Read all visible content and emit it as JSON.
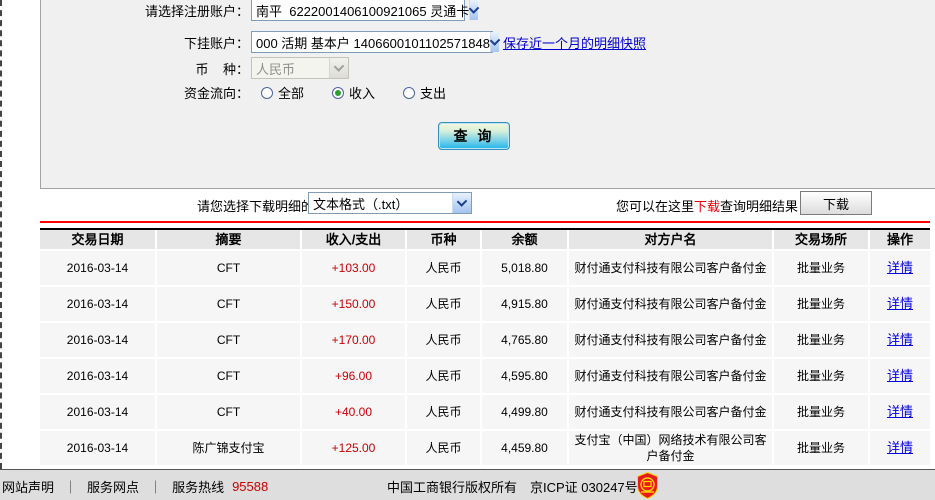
{
  "form": {
    "register_account": {
      "label": "请选择注册账户：",
      "value": "南平  6222001406100921065 灵通卡"
    },
    "sub_account": {
      "label": "下挂账户：",
      "value": "000 活期 基本户 1406600101102571848"
    },
    "snapshot_link": "保存近一个月的明细快照",
    "currency": {
      "label": "币    种：",
      "value": "人民币"
    },
    "flow": {
      "label": "资金流向：",
      "options": [
        {
          "label": "全部",
          "checked": false
        },
        {
          "label": "收入",
          "checked": true
        },
        {
          "label": "支出",
          "checked": false
        }
      ]
    },
    "query_button": "查 询"
  },
  "download": {
    "format_label": "请您选择下载明细的格式",
    "format_value": "文本格式（.txt）",
    "hint_prefix": "您可以在这里",
    "hint_red": "下载",
    "hint_suffix": "查询明细结果",
    "button": "下载"
  },
  "table": {
    "headers": [
      "交易日期",
      "摘要",
      "收入/支出",
      "币种",
      "余额",
      "对方户名",
      "交易场所",
      "操作"
    ],
    "rows": [
      {
        "date": "2016-03-14",
        "summary": "CFT",
        "amount": "+103.00",
        "currency": "人民币",
        "balance": "5,018.80",
        "counterparty": "财付通支付科技有限公司客户备付金",
        "venue": "批量业务",
        "action": "详情"
      },
      {
        "date": "2016-03-14",
        "summary": "CFT",
        "amount": "+150.00",
        "currency": "人民币",
        "balance": "4,915.80",
        "counterparty": "财付通支付科技有限公司客户备付金",
        "venue": "批量业务",
        "action": "详情"
      },
      {
        "date": "2016-03-14",
        "summary": "CFT",
        "amount": "+170.00",
        "currency": "人民币",
        "balance": "4,765.80",
        "counterparty": "财付通支付科技有限公司客户备付金",
        "venue": "批量业务",
        "action": "详情"
      },
      {
        "date": "2016-03-14",
        "summary": "CFT",
        "amount": "+96.00",
        "currency": "人民币",
        "balance": "4,595.80",
        "counterparty": "财付通支付科技有限公司客户备付金",
        "venue": "批量业务",
        "action": "详情"
      },
      {
        "date": "2016-03-14",
        "summary": "CFT",
        "amount": "+40.00",
        "currency": "人民币",
        "balance": "4,499.80",
        "counterparty": "财付通支付科技有限公司客户备付金",
        "venue": "批量业务",
        "action": "详情"
      },
      {
        "date": "2016-03-14",
        "summary": "陈广锦支付宝",
        "amount": "+125.00",
        "currency": "人民币",
        "balance": "4,459.80",
        "counterparty": "支付宝（中国）网络技术有限公司客户备付金",
        "venue": "批量业务",
        "action": "详情"
      }
    ]
  },
  "footer": {
    "link_statement": "网站声明",
    "link_branches": "服务网点",
    "separator": "｜",
    "hotline_label": "服务热线",
    "hotline_number": "95588",
    "copyright": "中国工商银行版权所有　京ICP证 030247号",
    "badge_icon": "police-badge-icon"
  },
  "colors": {
    "accent_red": "#cc0000",
    "line_red": "#ff0000",
    "link_blue": "#0000cc",
    "panel_gray": "#f0f0f0",
    "header_gray": "#e6e6e6",
    "row_gray": "#f6f6f6",
    "checked_green": "#2f9e2f"
  }
}
